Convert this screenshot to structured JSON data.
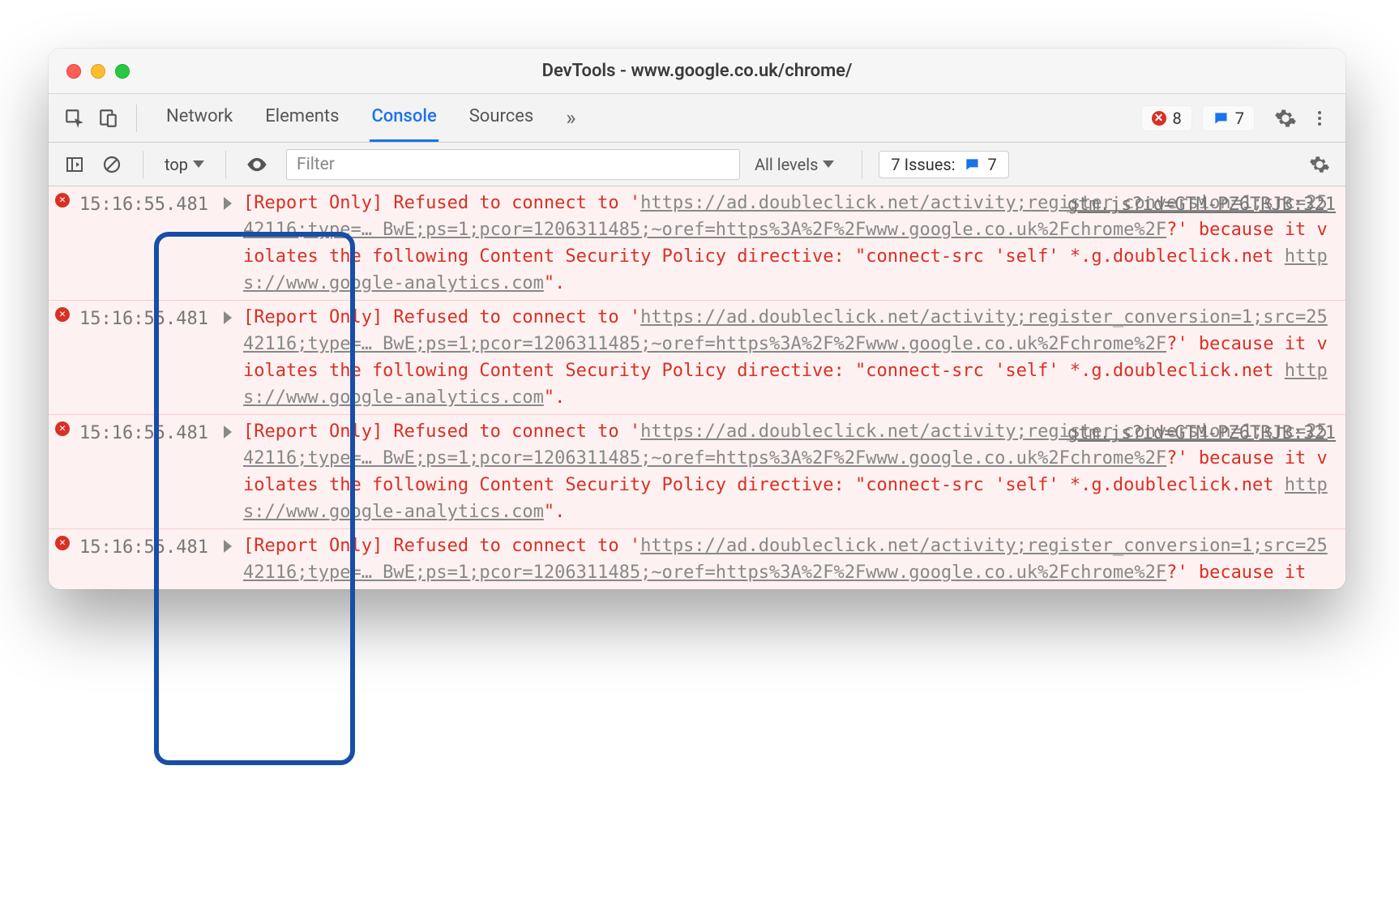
{
  "window": {
    "title": "DevTools - www.google.co.uk/chrome/"
  },
  "tabs": [
    "Network",
    "Elements",
    "Console",
    "Sources"
  ],
  "counts": {
    "errors": "8",
    "messages": "7"
  },
  "toolbar": {
    "context": "top",
    "filter_placeholder": "Filter",
    "levels": "All levels",
    "issues_label": "7 Issues:",
    "issues_count": "7"
  },
  "messages": [
    {
      "timestamp": "15:16:55.481",
      "source": "gtm.js?id=GTM-PZ6TRJB:321",
      "parts": [
        {
          "t": "red",
          "v": "[Report Only] Refused to connect to '"
        },
        {
          "t": "u",
          "v": "https://ad.doubleclick.net/activity;register_conversion=1;src=2542116;type=… BwE;ps=1;pcor=1206311485;~oref=https%3A%2F%2Fwww.google.co.uk%2Fchrome%2F"
        },
        {
          "t": "red",
          "v": "?' because it violates the following Content Security Policy directive: \"connect-src 'self' *.g.doubleclick.net "
        },
        {
          "t": "u",
          "v": "https://www.google-analytics.com"
        },
        {
          "t": "red",
          "v": "\"."
        }
      ]
    },
    {
      "timestamp": "15:16:55.481",
      "source": "",
      "parts": [
        {
          "t": "red",
          "v": "[Report Only] Refused to connect to '"
        },
        {
          "t": "u",
          "v": "https://ad.doubleclick.net/activity;register_conversion=1;src=2542116;type=… BwE;ps=1;pcor=1206311485;~oref=https%3A%2F%2Fwww.google.co.uk%2Fchrome%2F"
        },
        {
          "t": "red",
          "v": "?' because it violates the following Content Security Policy directive: \"connect-src 'self' *.g.doubleclick.net "
        },
        {
          "t": "u",
          "v": "https://www.google-analytics.com"
        },
        {
          "t": "red",
          "v": "\"."
        }
      ]
    },
    {
      "timestamp": "15:16:55.481",
      "source": "gtm.js?id=GTM-PZ6TRJB:321",
      "parts": [
        {
          "t": "red",
          "v": "[Report Only] Refused to connect to '"
        },
        {
          "t": "u",
          "v": "https://ad.doubleclick.net/activity;register_conversion=1;src=2542116;type=… BwE;ps=1;pcor=1206311485;~oref=https%3A%2F%2Fwww.google.co.uk%2Fchrome%2F"
        },
        {
          "t": "red",
          "v": "?' because it violates the following Content Security Policy directive: \"connect-src 'self' *.g.doubleclick.net "
        },
        {
          "t": "u",
          "v": "https://www.google-analytics.com"
        },
        {
          "t": "red",
          "v": "\"."
        }
      ]
    },
    {
      "timestamp": "15:16:55.481",
      "source": "",
      "partial": true,
      "parts": [
        {
          "t": "red",
          "v": "[Report Only] Refused to connect to '"
        },
        {
          "t": "u",
          "v": "https://ad.doubleclick.net/activity;register_conversion=1;src=2542116;type=… BwE;ps=1;pcor=1206311485;~oref=https%3A%2F%2Fwww.google.co.uk%2Fchrome%2F"
        },
        {
          "t": "red",
          "v": "?' because it"
        }
      ]
    }
  ]
}
